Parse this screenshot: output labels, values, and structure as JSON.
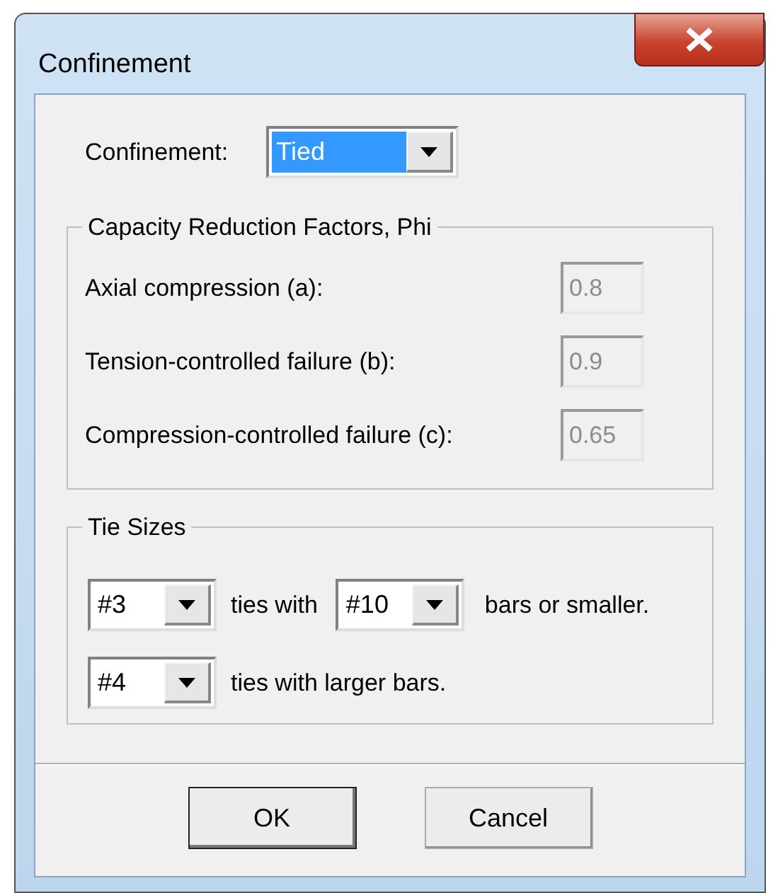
{
  "window": {
    "title": "Confinement"
  },
  "confinement": {
    "label": "Confinement:",
    "value": "Tied",
    "highlighted": true
  },
  "capacity_group": {
    "title": "Capacity Reduction Factors, Phi",
    "rows": [
      {
        "label": "Axial compression (a):",
        "value": "0.8",
        "disabled": true
      },
      {
        "label": "Tension-controlled failure (b):",
        "value": "0.9",
        "disabled": true
      },
      {
        "label": "Compression-controlled failure (c):",
        "value": "0.65",
        "disabled": true
      }
    ]
  },
  "tie_group": {
    "title": "Tie Sizes",
    "rows": [
      {
        "tie": "#3",
        "text_1": "ties with",
        "bar": "#10",
        "text_2": "bars or smaller."
      },
      {
        "tie": "#4",
        "text_1": "ties with larger bars."
      }
    ]
  },
  "buttons": [
    {
      "label": "OK",
      "default": true
    },
    {
      "label": "Cancel",
      "default": false
    }
  ]
}
